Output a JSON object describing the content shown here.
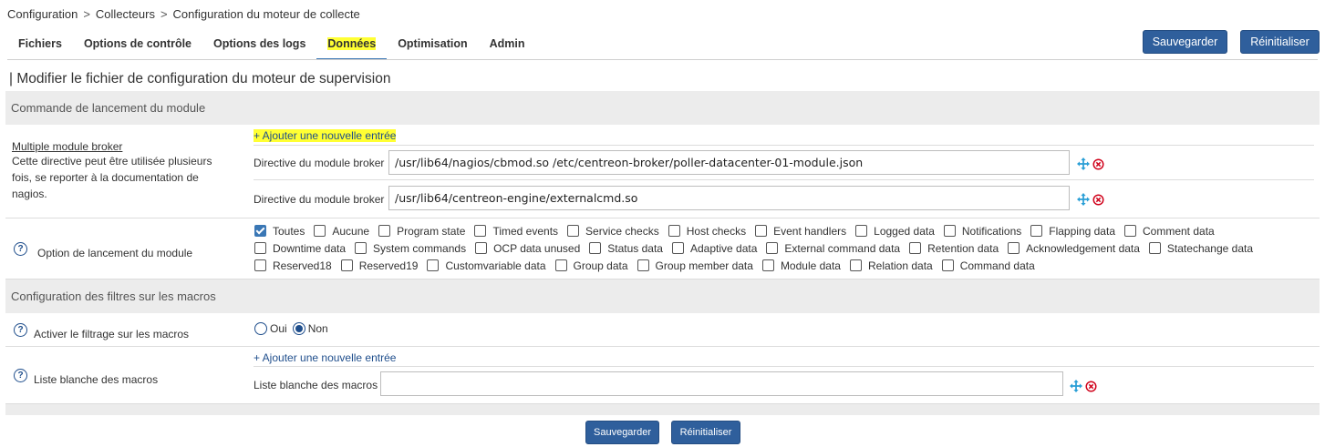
{
  "breadcrumb": {
    "items": [
      "Configuration",
      "Collecteurs",
      "Configuration du moteur de collecte"
    ],
    "separator": ">"
  },
  "tabs": [
    {
      "label": "Fichiers"
    },
    {
      "label": "Options de contrôle"
    },
    {
      "label": "Options des logs"
    },
    {
      "label": "Données",
      "active": true
    },
    {
      "label": "Optimisation"
    },
    {
      "label": "Admin"
    }
  ],
  "actions": {
    "save": "Sauvegarder",
    "reset": "Réinitialiser"
  },
  "page_title": "| Modifier le fichier de configuration du moteur de supervision",
  "sections": {
    "module_launch": "Commande de lancement du module",
    "macro_filters": "Configuration des filtres sur les macros"
  },
  "broker": {
    "title": "Multiple module broker",
    "description": "Cette directive peut être utilisée plusieurs fois, se reporter à la documentation de nagios.",
    "add_entry": "+ Ajouter une nouvelle entrée",
    "field_label": "Directive du module broker",
    "entries": [
      "/usr/lib64/nagios/cbmod.so /etc/centreon-broker/poller-datacenter-01-module.json",
      "/usr/lib64/centreon-engine/externalcmd.so"
    ]
  },
  "launch_options": {
    "label": "Option de lancement du module",
    "rows": [
      [
        {
          "label": "Toutes",
          "checked": true
        },
        {
          "label": "Aucune",
          "checked": false
        },
        {
          "label": "Program state",
          "checked": false
        },
        {
          "label": "Timed events",
          "checked": false
        },
        {
          "label": "Service checks",
          "checked": false
        },
        {
          "label": "Host checks",
          "checked": false
        },
        {
          "label": "Event handlers",
          "checked": false
        },
        {
          "label": "Logged data",
          "checked": false
        },
        {
          "label": "Notifications",
          "checked": false
        },
        {
          "label": "Flapping data",
          "checked": false
        },
        {
          "label": "Comment data",
          "checked": false
        }
      ],
      [
        {
          "label": "Downtime data",
          "checked": false
        },
        {
          "label": "System commands",
          "checked": false
        },
        {
          "label": "OCP data unused",
          "checked": false
        },
        {
          "label": "Status data",
          "checked": false
        },
        {
          "label": "Adaptive data",
          "checked": false
        },
        {
          "label": "External command data",
          "checked": false
        },
        {
          "label": "Retention data",
          "checked": false
        },
        {
          "label": "Acknowledgement data",
          "checked": false
        },
        {
          "label": "Statechange data",
          "checked": false
        }
      ],
      [
        {
          "label": "Reserved18",
          "checked": false
        },
        {
          "label": "Reserved19",
          "checked": false
        },
        {
          "label": "Customvariable data",
          "checked": false
        },
        {
          "label": "Group data",
          "checked": false
        },
        {
          "label": "Group member data",
          "checked": false
        },
        {
          "label": "Module data",
          "checked": false
        },
        {
          "label": "Relation data",
          "checked": false
        },
        {
          "label": "Command data",
          "checked": false
        }
      ]
    ]
  },
  "macro_filter": {
    "label": "Activer le filtrage sur les macros",
    "options": [
      {
        "label": "Oui",
        "selected": false
      },
      {
        "label": "Non",
        "selected": true
      }
    ]
  },
  "macro_whitelist": {
    "label": "Liste blanche des macros",
    "add_entry": "+ Ajouter une nouvelle entrée",
    "field_label": "Liste blanche des macros",
    "value": ""
  },
  "icons": {
    "help": "question-circle-icon",
    "move": "move-arrows-icon",
    "delete": "delete-circle-icon"
  },
  "colors": {
    "primary": "#2f5f9c",
    "highlight": "#ffff33",
    "move_icon": "#2a9fd6",
    "delete_icon": "#d0021b"
  }
}
